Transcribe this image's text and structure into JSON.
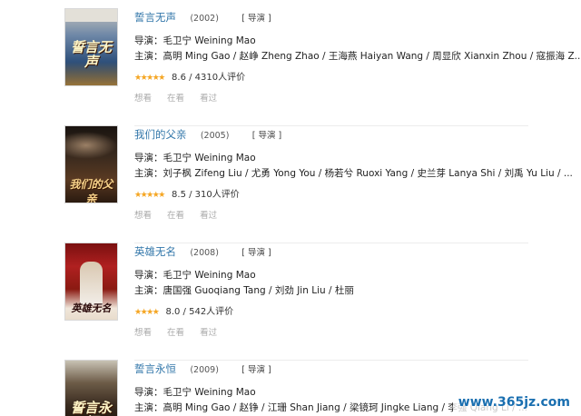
{
  "works": [
    {
      "title": "誓言无声",
      "year": "(2002)",
      "role": "[ 导演 ]",
      "director": "导演：毛卫宁 Weining Mao",
      "cast": "主演：高明 Ming Gao / 赵峥 Zheng Zhao / 王海燕 Haiyan Wang / 周显欣 Xianxin Zhou / 寇振海 Z...",
      "stars": "★★★★★",
      "rating": "8.6 / 4310人评价",
      "poster_text": "誓言无声",
      "actions": [
        "想看",
        "在看",
        "看过"
      ]
    },
    {
      "title": "我们的父亲",
      "year": "(2005)",
      "role": "[ 导演 ]",
      "director": "导演：毛卫宁 Weining Mao",
      "cast": "主演：刘子枫 Zifeng Liu / 尤勇 Yong You / 杨若兮 Ruoxi Yang / 史兰芽 Lanya Shi / 刘禹 Yu Liu / ...",
      "stars": "★★★★★",
      "rating": "8.5 / 310人评价",
      "poster_text": "我们的父亲",
      "actions": [
        "想看",
        "在看",
        "看过"
      ]
    },
    {
      "title": "英雄无名",
      "year": "(2008)",
      "role": "[ 导演 ]",
      "director": "导演：毛卫宁 Weining Mao",
      "cast": "主演：唐国强 Guoqiang Tang / 刘劲 Jin Liu / 杜丽",
      "stars": "★★★★",
      "rating": "8.0 / 542人评价",
      "poster_text": "英雄无名",
      "actions": [
        "想看",
        "在看",
        "看过"
      ]
    },
    {
      "title": "誓言永恒",
      "year": "(2009)",
      "role": "[ 导演 ]",
      "director": "导演：毛卫宁 Weining Mao",
      "cast": "主演：高明 Ming Gao / 赵铮 / 江珊 Shan Jiang / 梁镜珂 Jingke Liang / 李强 Qiang Li / ...",
      "poster_text": "誓言永恒"
    }
  ],
  "watermark": "www.365jz.com",
  "colors": {
    "title": "#3377aa",
    "star": "#f5a623",
    "muted": "#aaaaaa"
  }
}
